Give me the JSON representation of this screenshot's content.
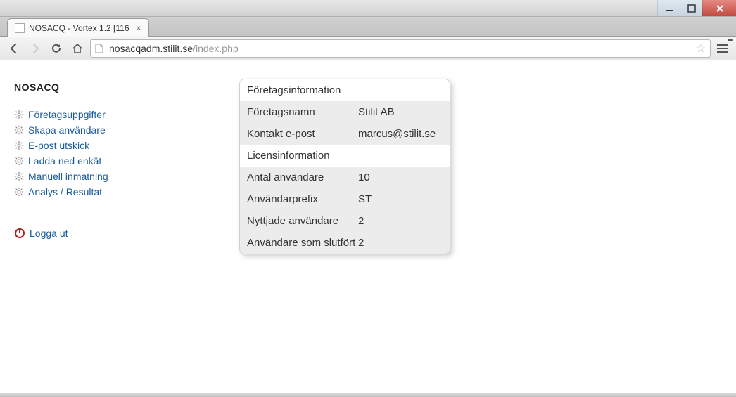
{
  "window": {
    "tab_title": "NOSACQ - Vortex 1.2 [116"
  },
  "toolbar": {
    "url_host": "nosacqadm.stilit.se",
    "url_path": "/index.php"
  },
  "sidebar": {
    "app_title": "NOSACQ",
    "items": [
      {
        "label": "Företagsuppgifter"
      },
      {
        "label": "Skapa användare"
      },
      {
        "label": "E-post utskick"
      },
      {
        "label": "Ladda ned enkät"
      },
      {
        "label": "Manuell inmatning"
      },
      {
        "label": "Analys / Resultat"
      }
    ],
    "logout_label": "Logga ut"
  },
  "panel": {
    "section1_title": "Företagsinformation",
    "rows1": [
      {
        "label": "Företagsnamn",
        "value": "Stilit AB"
      },
      {
        "label": "Kontakt e-post",
        "value": "marcus@stilit.se"
      }
    ],
    "section2_title": "Licensinformation",
    "rows2": [
      {
        "label": "Antal användare",
        "value": "10"
      },
      {
        "label": "Användarprefix",
        "value": "ST"
      },
      {
        "label": "Nyttjade användare",
        "value": "2"
      },
      {
        "label": "Användare som slutfört",
        "value": "2"
      }
    ]
  }
}
